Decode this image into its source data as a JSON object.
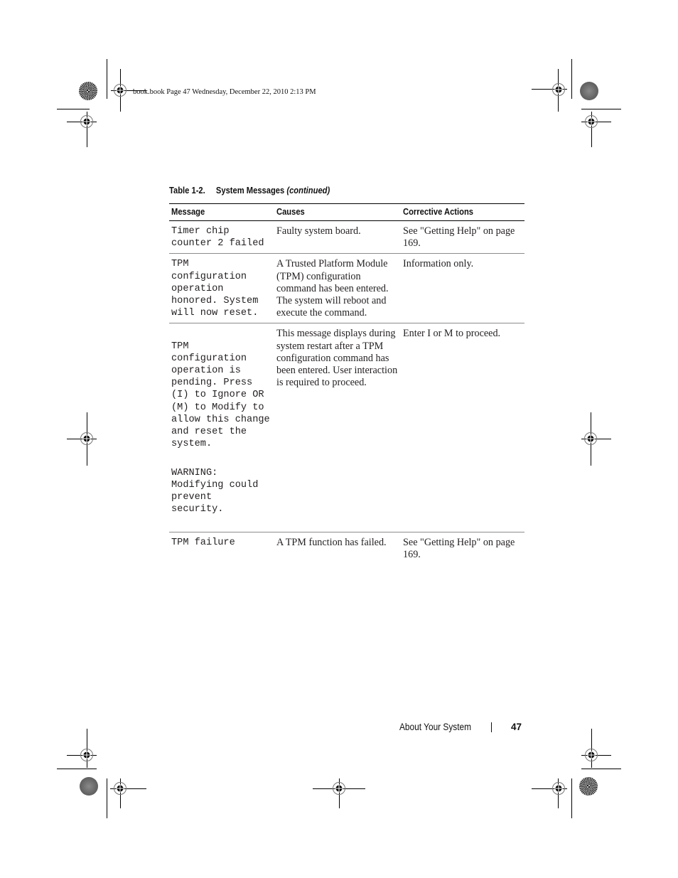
{
  "slug": "book.book  Page 47  Wednesday, December 22, 2010  2:13 PM",
  "table": {
    "number": "Table 1-2.",
    "title": "System Messages",
    "title_suffix": "(continued)",
    "headers": [
      "Message",
      "Causes",
      "Corrective Actions"
    ],
    "rows": [
      {
        "message": [
          "Timer chip\ncounter 2 failed"
        ],
        "causes": "Faulty system board.",
        "actions": "See \"Getting Help\" on page 169."
      },
      {
        "message": [
          "TPM\nconfiguration\noperation\nhonored. System\nwill now reset."
        ],
        "causes": "A Trusted Platform Module (TPM) configuration command has been entered. The system will reboot and execute the command.",
        "actions": "Information only."
      },
      {
        "message": [
          "TPM\nconfiguration\noperation is\npending. Press\n(I) to Ignore OR\n(M) to Modify to\nallow this change\nand reset the\nsystem.",
          "WARNING:\nModifying could\nprevent\nsecurity."
        ],
        "causes": "This message displays during system restart after a TPM configuration command has been entered. User interaction is required to proceed.",
        "actions": "Enter I or M to proceed."
      },
      {
        "message": [
          "TPM failure"
        ],
        "causes": "A TPM function has failed.",
        "actions": "See \"Getting Help\" on page 169."
      }
    ]
  },
  "footer": {
    "section": "About Your System",
    "page_number": "47"
  }
}
